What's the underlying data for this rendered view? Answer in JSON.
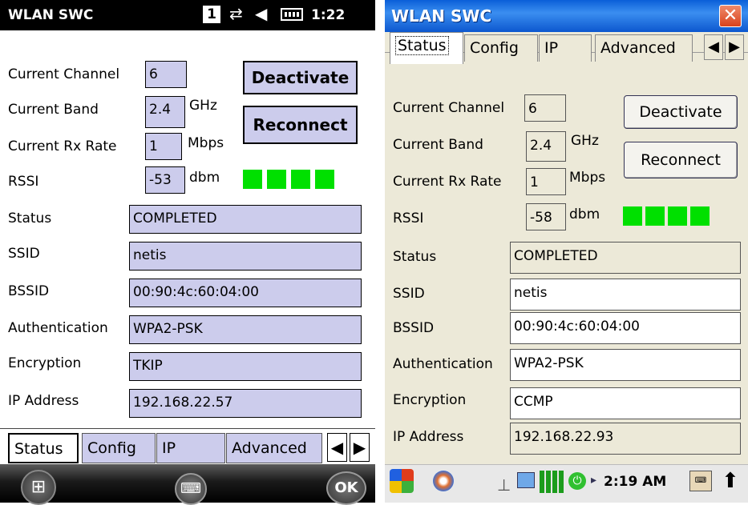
{
  "left": {
    "app_title": "WLAN SWC",
    "status_bar": {
      "sim": "1",
      "time": "1:22"
    },
    "fields": {
      "channel_label": "Current Channel",
      "channel_value": "6",
      "band_label": "Current Band",
      "band_value": "2.4",
      "band_unit": "GHz",
      "rx_label": "Current Rx Rate",
      "rx_value": "1",
      "rx_unit": "Mbps",
      "rssi_label": "RSSI",
      "rssi_value": "-53",
      "rssi_unit": "dbm",
      "status_label": "Status",
      "status_value": "COMPLETED",
      "ssid_label": "SSID",
      "ssid_value": "netis",
      "bssid_label": "BSSID",
      "bssid_value": "00:90:4c:60:04:00",
      "auth_label": "Authentication",
      "auth_value": "WPA2-PSK",
      "enc_label": "Encryption",
      "enc_value": "TKIP",
      "ip_label": "IP Address",
      "ip_value": "192.168.22.57"
    },
    "signal_bars": 4,
    "buttons": {
      "deactivate": "Deactivate",
      "reconnect": "Reconnect"
    },
    "tabs": [
      "Status",
      "Config",
      "IP",
      "Advanced"
    ],
    "softkeys": {
      "ok": "OK"
    },
    "colors": {
      "field_bg": "#ccccec",
      "signal": "#00e000"
    }
  },
  "right": {
    "app_title": "WLAN SWC",
    "tabs": [
      "Status",
      "Config",
      "IP",
      "Advanced"
    ],
    "fields": {
      "channel_label": "Current Channel",
      "channel_value": "6",
      "band_label": "Current Band",
      "band_value": "2.4",
      "band_unit": "GHz",
      "rx_label": "Current Rx Rate",
      "rx_value": "1",
      "rx_unit": "Mbps",
      "rssi_label": "RSSI",
      "rssi_value": "-58",
      "rssi_unit": "dbm",
      "status_label": "Status",
      "status_value": "COMPLETED",
      "ssid_label": "SSID",
      "ssid_value": "netis",
      "bssid_label": "BSSID",
      "bssid_value": "00:90:4c:60:04:00",
      "auth_label": "Authentication",
      "auth_value": "WPA2-PSK",
      "enc_label": "Encryption",
      "enc_value": "CCMP",
      "ip_label": "IP Address",
      "ip_value": "192.168.22.93"
    },
    "signal_bars": 4,
    "buttons": {
      "deactivate": "Deactivate",
      "reconnect": "Reconnect"
    },
    "taskbar": {
      "time": "2:19 AM"
    },
    "colors": {
      "title_bar": "#0a5fd8",
      "close": "#d8421c",
      "window_bg": "#ece9d8"
    }
  }
}
